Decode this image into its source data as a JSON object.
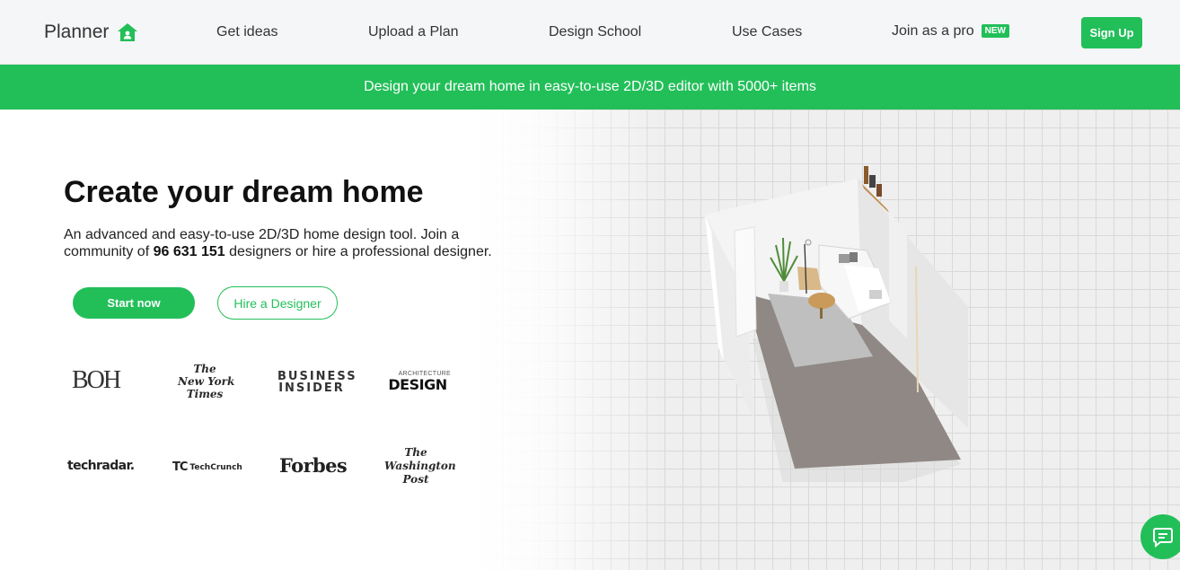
{
  "header": {
    "logo_text": "Planner",
    "logo_icon": "house-icon",
    "nav": [
      {
        "label": "Get ideas"
      },
      {
        "label": "Upload a Plan"
      },
      {
        "label": "Design School"
      },
      {
        "label": "Use Cases"
      },
      {
        "label": "Join as a pro",
        "badge": "NEW"
      }
    ],
    "signup_label": "Sign Up"
  },
  "banner": {
    "text": "Design your dream home in easy-to-use 2D/3D editor with 5000+ items"
  },
  "hero": {
    "title": "Create your dream home",
    "desc_part1": "An advanced and easy-to-use 2D/3D home design tool. Join a community of ",
    "designer_count": "96 631 151",
    "desc_part2": " designers or hire a professional designer.",
    "start_label": "Start now",
    "hire_label": "Hire a Designer"
  },
  "press": {
    "boh": "BOH",
    "nyt_line1": "The",
    "nyt_line2": "New York",
    "nyt_line3": "Times",
    "bi_line1": "BUSINESS",
    "bi_line2": "INSIDER",
    "ad_small": "ARCHITECTURE",
    "ad_big": "DESIGN",
    "techradar": "techradar.",
    "techcrunch_mark": "TC",
    "techcrunch": "TechCrunch",
    "forbes": "Forbes",
    "wp_line1": "The",
    "wp_line2": "Washington",
    "wp_line3": "Post"
  },
  "chat": {
    "icon": "chat-bubble-icon"
  },
  "colors": {
    "accent": "#22bf59",
    "header_bg": "#f5f6f7"
  }
}
